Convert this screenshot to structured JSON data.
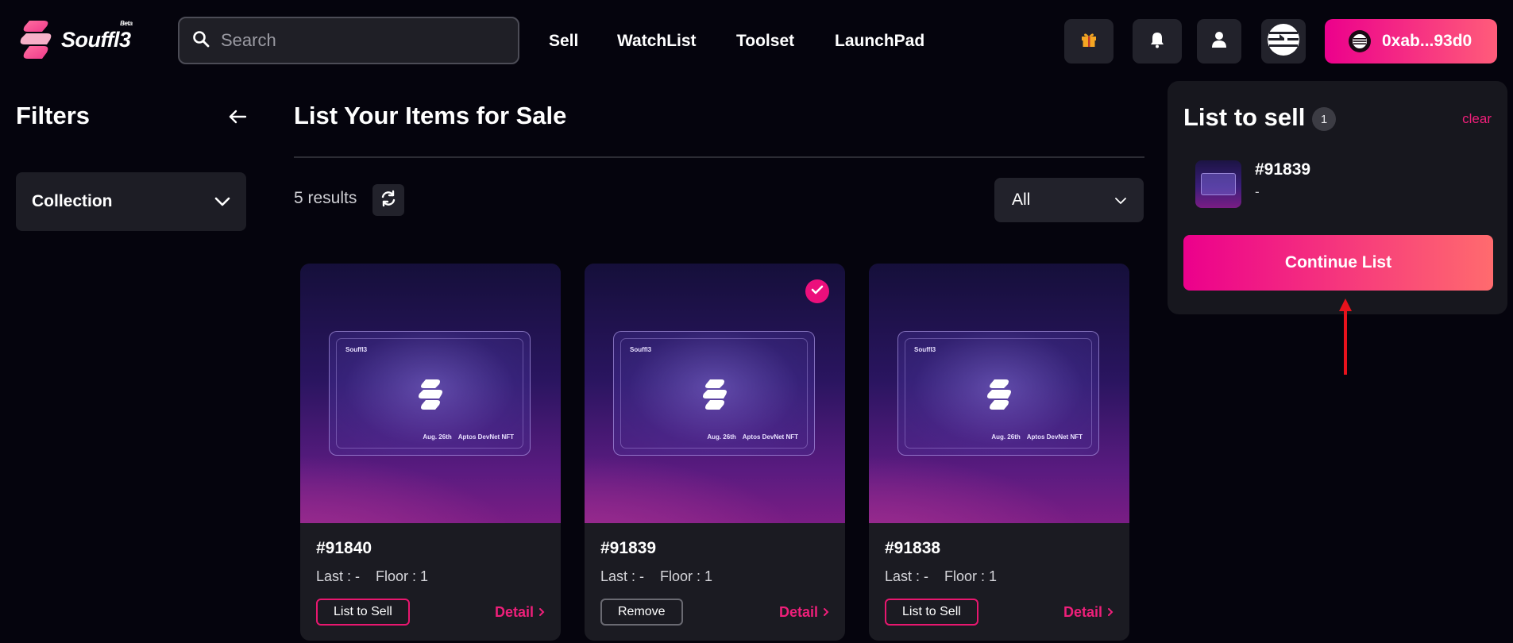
{
  "header": {
    "logo_text": "Souffl3",
    "logo_badge": "Beta",
    "search_placeholder": "Search",
    "nav": [
      "Sell",
      "WatchList",
      "Toolset",
      "LaunchPad"
    ],
    "wallet_label": "0xab...93d0"
  },
  "filters": {
    "title": "Filters",
    "collection_label": "Collection"
  },
  "main": {
    "title": "List Your Items for Sale",
    "results": "5 results",
    "select_value": "All"
  },
  "cards": [
    {
      "name": "#91840",
      "last": "Last : -",
      "floor": "Floor : 1",
      "action": "List to Sell",
      "detail": "Detail",
      "art_brand": "Souffl3",
      "art_date": "Aug. 26th",
      "art_label": "Aptos DevNet NFT"
    },
    {
      "name": "#91839",
      "last": "Last : -",
      "floor": "Floor : 1",
      "action": "Remove",
      "detail": "Detail",
      "art_brand": "Souffl3",
      "art_date": "Aug. 26th",
      "art_label": "Aptos DevNet NFT"
    },
    {
      "name": "#91838",
      "last": "Last : -",
      "floor": "Floor : 1",
      "action": "List to Sell",
      "detail": "Detail",
      "art_brand": "Souffl3",
      "art_date": "Aug. 26th",
      "art_label": "Aptos DevNet NFT"
    }
  ],
  "sell_panel": {
    "title": "List to sell",
    "count": "1",
    "clear": "clear",
    "item_name": "#91839",
    "item_sub": "-",
    "continue_label": "Continue List"
  },
  "colors": {
    "accent": "#ec0f7c",
    "background": "#05040d",
    "card": "#1b1b22"
  },
  "icons": {
    "search": "search-icon",
    "back": "arrow-left-icon",
    "chevron": "chevron-down-icon",
    "refresh": "refresh-icon",
    "gift": "gift-icon",
    "bell": "bell-icon",
    "user": "user-icon",
    "chain": "aptos-icon",
    "check": "check-icon"
  }
}
